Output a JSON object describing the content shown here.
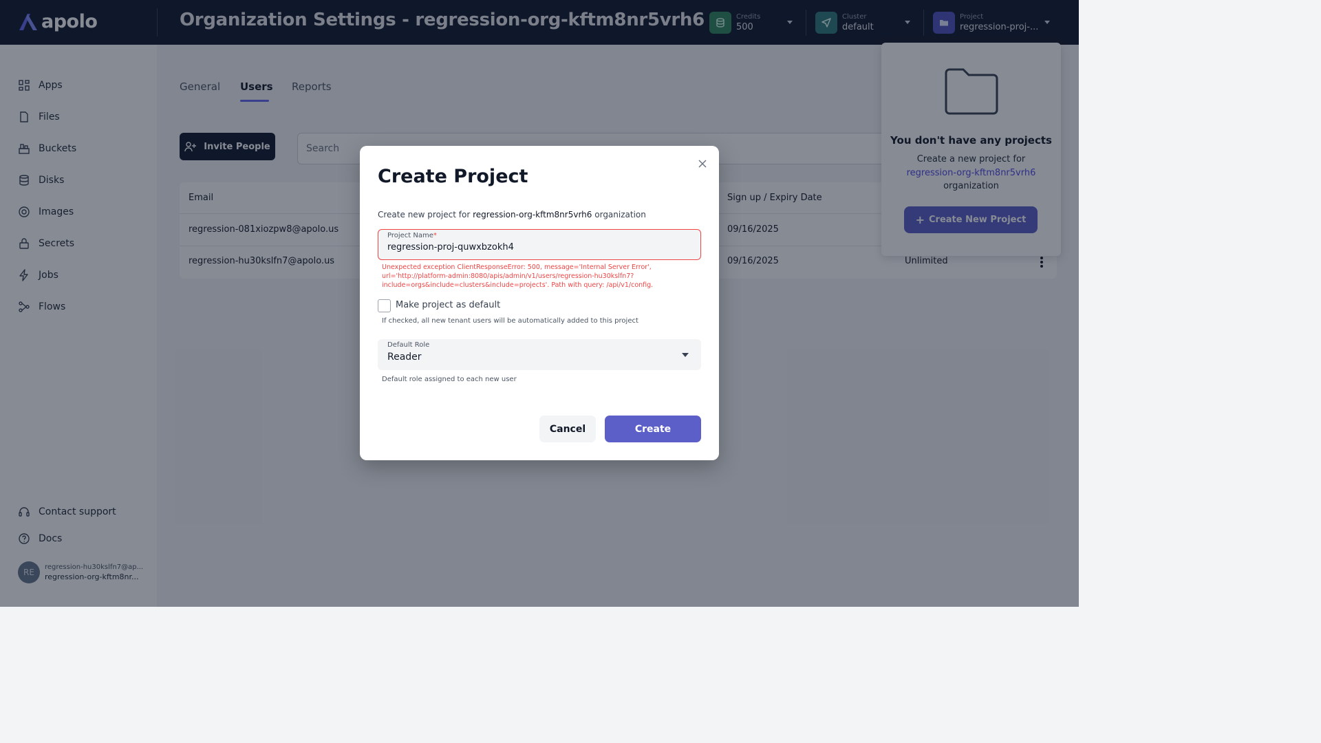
{
  "app": {
    "name": "apolo"
  },
  "header": {
    "title": "Organization Settings - regression-org-kftm8nr5vrh6",
    "credits": {
      "caption": "Credits",
      "value": "500",
      "icon": "coins-icon",
      "color": "#2f855a"
    },
    "cluster": {
      "caption": "Cluster",
      "value": "default",
      "icon": "send-icon",
      "color": "#2c7a7b"
    },
    "project": {
      "caption": "Project",
      "value": "regression-proj-...",
      "icon": "folder-icon",
      "color": "#4c51bf"
    }
  },
  "sidebar": {
    "items": [
      {
        "label": "Apps",
        "icon": "apps-grid-icon"
      },
      {
        "label": "Files",
        "icon": "file-icon"
      },
      {
        "label": "Buckets",
        "icon": "bucket-icon"
      },
      {
        "label": "Disks",
        "icon": "database-icon"
      },
      {
        "label": "Images",
        "icon": "image-icon"
      },
      {
        "label": "Secrets",
        "icon": "lock-icon"
      },
      {
        "label": "Jobs",
        "icon": "lightning-icon"
      },
      {
        "label": "Flows",
        "icon": "flow-icon"
      }
    ],
    "bottom": [
      {
        "label": "Contact support",
        "icon": "headset-icon"
      },
      {
        "label": "Docs",
        "icon": "help-circle-icon"
      }
    ],
    "user": {
      "initials": "RE",
      "email": "regression-hu30kslfn7@ap...",
      "org": "regression-org-kftm8nr..."
    }
  },
  "tabs": [
    {
      "label": "General",
      "active": false
    },
    {
      "label": "Users",
      "active": true
    },
    {
      "label": "Reports",
      "active": false
    }
  ],
  "toolbar": {
    "invite_label": "Invite People",
    "search_placeholder": "Search"
  },
  "table": {
    "headers": [
      "Email",
      "Sign up / Expiry Date"
    ],
    "rows": [
      {
        "email": "regression-081xiozpw8@apolo.us",
        "date": "09/16/2025",
        "limit": ""
      },
      {
        "email": "regression-hu30kslfn7@apolo.us",
        "date": "09/16/2025",
        "limit": "Unlimited"
      }
    ]
  },
  "projects_popover": {
    "title": "You don't have any projects",
    "text_before": "Create a new project for",
    "org_link": "regression-org-kftm8nr5vrh6",
    "text_after": "organization",
    "button_label": "Create New Project"
  },
  "modal": {
    "title": "Create Project",
    "subtitle_prefix": "Create new project for",
    "subtitle_org": "regression-org-kftm8nr5vrh6",
    "subtitle_suffix": "organization",
    "project_name_label": "Project Name",
    "project_name_required": "*",
    "project_name_value": "regression-proj-quwxbzokh4",
    "error": "Unexpected exception ClientResponseError: 500, message='Internal Server Error', url='http://platform-admin:8080/apis/admin/v1/users/regression-hu30kslfn7?include=orgs&include=clusters&include=projects'. Path with query: /api/v1/config.",
    "default_checkbox_label": "Make project as default",
    "default_checkbox_checked": false,
    "default_checkbox_help": "If checked, all new tenant users will be automatically added to this project",
    "role_label": "Default Role",
    "role_value": "Reader",
    "role_help": "Default role assigned to each new user",
    "cancel_label": "Cancel",
    "create_label": "Create"
  }
}
